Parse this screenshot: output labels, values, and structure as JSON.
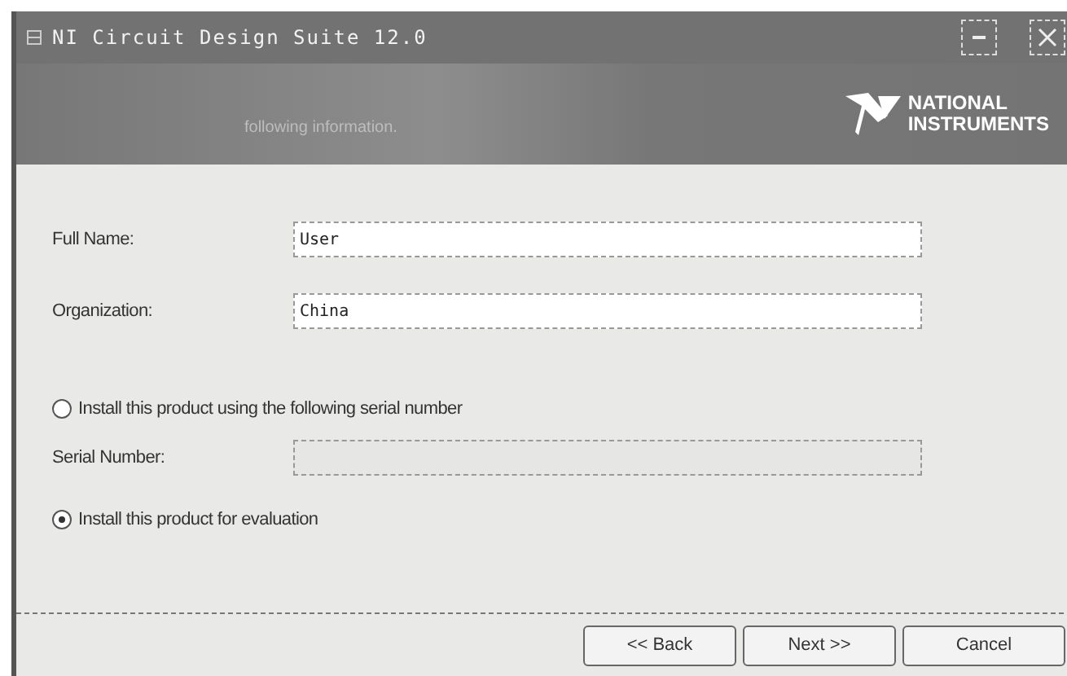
{
  "window": {
    "title": "NI Circuit Design Suite 12.0"
  },
  "header": {
    "subtitle": "following information.",
    "logo_lines": [
      "NATIONAL",
      "INSTRUMENTS"
    ]
  },
  "fields": [
    {
      "label": "Full Name:",
      "value": "User"
    },
    {
      "label": "Organization:",
      "value": "China"
    }
  ],
  "options": [
    {
      "label": "Install this product using the following serial number",
      "selected": false,
      "field": {
        "label": "Serial Number:",
        "disabled": true
      }
    },
    {
      "label": "Install this product for evaluation",
      "selected": true
    }
  ],
  "buttons": [
    "<< Back",
    "Next >>",
    "Cancel"
  ]
}
